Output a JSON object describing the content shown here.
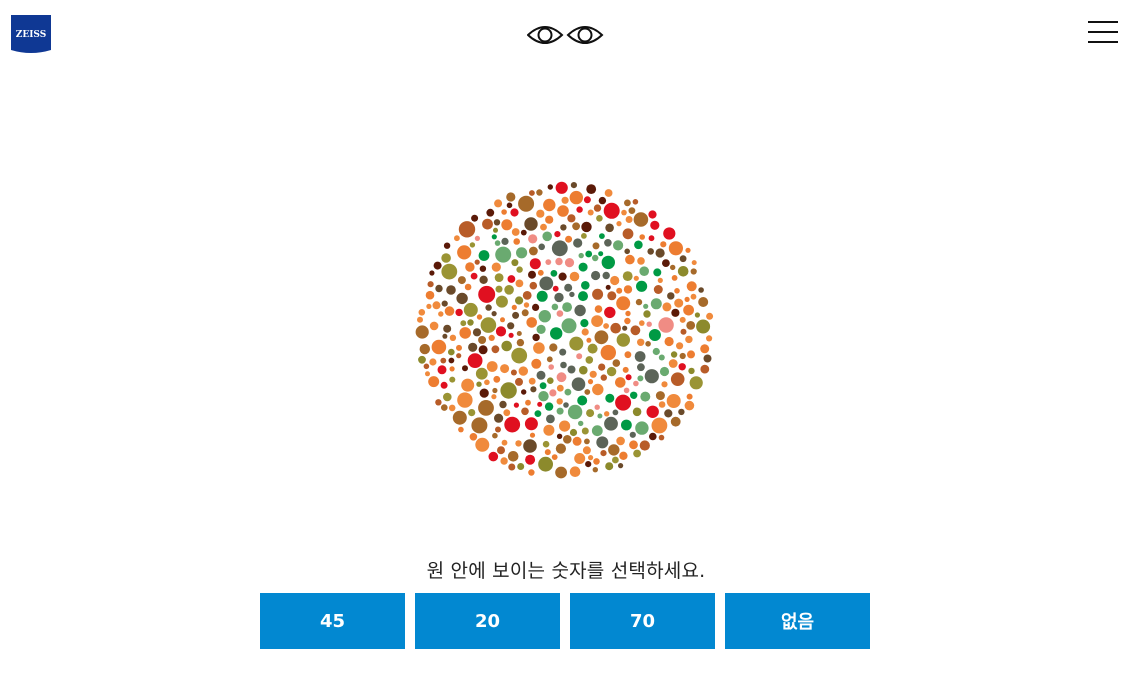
{
  "header": {
    "logo_text": "ZEISS",
    "logo_icon": "zeiss-logo",
    "center_icon": "eyes-icon",
    "menu_icon": "hamburger-menu-icon"
  },
  "test": {
    "plate_icon": "ishihara-color-plate",
    "instruction": "원 안에 보이는 숫자를 선택하세요.",
    "answers": [
      "45",
      "20",
      "70",
      "없음"
    ]
  },
  "colors": {
    "brand_blue": "#0f3894",
    "button_blue": "#0288d1",
    "plate_palette": [
      "#ed7d31",
      "#f08a3c",
      "#b85c28",
      "#a66a2a",
      "#8c8a2c",
      "#9a9434",
      "#6a4a2a",
      "#5b1a08",
      "#e01020",
      "#009a44",
      "#6aaa70",
      "#5c6458",
      "#f08c84"
    ]
  }
}
